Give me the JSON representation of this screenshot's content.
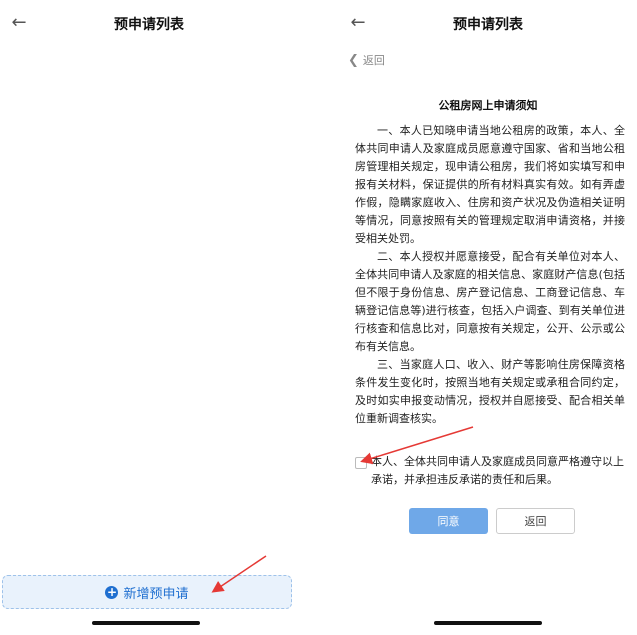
{
  "left_screen": {
    "title": "预申请列表",
    "add_button_label": "新增预申请",
    "icons": {
      "back": "back-arrow-icon",
      "add": "plus-circle-icon"
    }
  },
  "right_screen": {
    "title": "预申请列表",
    "return_link": "返回",
    "notice_title": "公租房网上申请须知",
    "paragraphs": [
      "一、本人已知晓申请当地公租房的政策，本人、全体共同申请人及家庭成员愿意遵守国家、省和当地公租房管理相关规定，现申请公租房，我们将如实填写和申报有关材料，保证提供的所有材料真实有效。如有弄虚作假，隐瞒家庭收入、住房和资产状况及伪造相关证明等情况，同意按照有关的管理规定取消申请资格，并接受相关处罚。",
      "二、本人授权并愿意接受，配合有关单位对本人、全体共同申请人及家庭的相关信息、家庭财产信息(包括但不限于身份信息、房产登记信息、工商登记信息、车辆登记信息等)进行核查，包括入户调查、到有关单位进行核查和信息比对，同意按有关规定，公开、公示或公布有关信息。",
      "三、当家庭人口、收入、财产等影响住房保障资格条件发生变化时，按照当地有关规定或承租合同约定，及时如实申报变动情况，授权并自愿接受、配合相关单位重新调查核实。"
    ],
    "agree_text": "本人、全体共同申请人及家庭成员同意严格遵守以上承诺，并承担违反承诺的责任和后果。",
    "agree_button": "同意",
    "return_button": "返回",
    "icons": {
      "back": "back-arrow-icon",
      "chevron": "chevron-left-icon"
    }
  },
  "colors": {
    "accent": "#1f6fd0",
    "agree_button_bg": "#6fa8e8",
    "add_button_bg": "#e9f2fc",
    "annotation_arrow": "#e53935"
  }
}
